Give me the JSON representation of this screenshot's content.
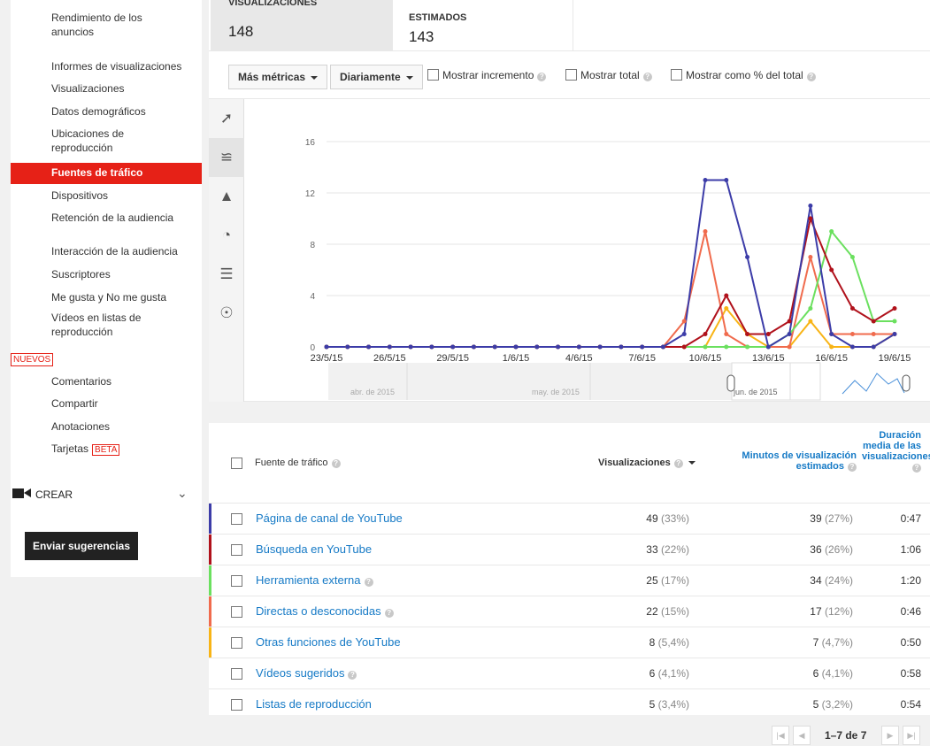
{
  "sidebar": {
    "items": [
      {
        "label": "Rendimiento de los",
        "label2": "anuncios"
      },
      {
        "label": "Informes de visualizaciones"
      },
      {
        "label": "Visualizaciones"
      },
      {
        "label": "Datos demográficos"
      },
      {
        "label": "Ubicaciones de",
        "label2": "reproducción"
      },
      {
        "label": "Fuentes de tráfico"
      },
      {
        "label": "Dispositivos"
      },
      {
        "label": "Retención de la audiencia"
      },
      {
        "label": "Interacción de la audiencia"
      },
      {
        "label": "Suscriptores"
      },
      {
        "label": "Me gusta y No me gusta"
      },
      {
        "label": "Vídeos en listas de",
        "label2": "reproducción"
      },
      {
        "label": "Comentarios"
      },
      {
        "label": "Compartir"
      },
      {
        "label": "Anotaciones"
      },
      {
        "label": "Tarjetas"
      }
    ],
    "nuevos_badge": "NUEVOS",
    "beta_badge": "BETA",
    "crear_label": "CREAR",
    "feedback_button": "Enviar sugerencias"
  },
  "metrics": {
    "views_title": "VISUALIZACIONES",
    "views_value": "148",
    "est_title": "ESTIMADOS",
    "est_value": "143"
  },
  "toolbar": {
    "more_metrics": "Más métricas",
    "daily": "Diariamente",
    "show_increment": "Mostrar incremento",
    "show_total": "Mostrar total",
    "show_pct": "Mostrar como % del total"
  },
  "chart_data": {
    "type": "line",
    "x": [
      "23/5/15",
      "24/5/15",
      "25/5/15",
      "26/5/15",
      "27/5/15",
      "28/5/15",
      "29/5/15",
      "30/5/15",
      "31/5/15",
      "1/6/15",
      "2/6/15",
      "3/6/15",
      "4/6/15",
      "5/6/15",
      "6/6/15",
      "7/6/15",
      "8/6/15",
      "9/6/15",
      "10/6/15",
      "11/6/15",
      "12/6/15",
      "13/6/15",
      "14/6/15",
      "15/6/15",
      "16/6/15",
      "17/6/15",
      "18/6/15",
      "19/6/15"
    ],
    "x_tick_labels": [
      "23/5/15",
      "26/5/15",
      "29/5/15",
      "1/6/15",
      "4/6/15",
      "7/6/15",
      "10/6/15",
      "13/6/15",
      "16/6/15",
      "19/6/15"
    ],
    "y_ticks": [
      0,
      4,
      8,
      12,
      16
    ],
    "ylim": [
      0,
      16
    ],
    "series": [
      {
        "color": "#3c3ca8",
        "values": [
          0,
          0,
          0,
          0,
          0,
          0,
          0,
          0,
          0,
          0,
          0,
          0,
          0,
          0,
          0,
          0,
          0,
          1,
          13,
          13,
          7,
          0,
          1,
          11,
          1,
          0,
          0,
          1
        ]
      },
      {
        "color": "#b0111b",
        "values": [
          0,
          0,
          0,
          0,
          0,
          0,
          0,
          0,
          0,
          0,
          0,
          0,
          0,
          0,
          0,
          0,
          0,
          0,
          1,
          4,
          1,
          1,
          2,
          10,
          6,
          3,
          2,
          3
        ]
      },
      {
        "color": "#6be05f",
        "values": [
          0,
          0,
          0,
          0,
          0,
          0,
          0,
          0,
          0,
          0,
          0,
          0,
          0,
          0,
          0,
          0,
          0,
          0,
          0,
          0,
          0,
          0,
          1,
          3,
          9,
          7,
          2,
          2
        ]
      },
      {
        "color": "#f06b4d",
        "values": [
          0,
          0,
          0,
          0,
          0,
          0,
          0,
          0,
          0,
          0,
          0,
          0,
          0,
          0,
          0,
          0,
          0,
          2,
          9,
          1,
          0,
          0,
          0,
          7,
          1,
          1,
          1,
          1
        ]
      },
      {
        "color": "#f8b416",
        "values": [
          0,
          0,
          0,
          0,
          0,
          0,
          0,
          0,
          0,
          0,
          0,
          0,
          0,
          0,
          0,
          0,
          0,
          0,
          0,
          3,
          1,
          0,
          0,
          2,
          0,
          0,
          0,
          1
        ]
      }
    ],
    "navigator_labels": [
      "abr. de 2015",
      "may. de 2015",
      "jun. de 2015"
    ]
  },
  "table": {
    "col_source": "Fuente de tráfico",
    "col_views": "Visualizaciones",
    "col_minutes": "Minutos de visualización estimados",
    "col_duration": "Duración media de las visualizaciones",
    "rows": [
      {
        "source": "Página de canal de YouTube",
        "help": false,
        "color": "#3c3ca8",
        "views": "49",
        "views_pct": "(33%)",
        "minutes": "39",
        "minutes_pct": "(27%)",
        "duration": "0:47"
      },
      {
        "source": "Búsqueda en YouTube",
        "help": false,
        "color": "#b0111b",
        "views": "33",
        "views_pct": "(22%)",
        "minutes": "36",
        "minutes_pct": "(26%)",
        "duration": "1:06"
      },
      {
        "source": "Herramienta externa",
        "help": true,
        "color": "#6be05f",
        "views": "25",
        "views_pct": "(17%)",
        "minutes": "34",
        "minutes_pct": "(24%)",
        "duration": "1:20"
      },
      {
        "source": "Directas o desconocidas",
        "help": true,
        "color": "#f06b4d",
        "views": "22",
        "views_pct": "(15%)",
        "minutes": "17",
        "minutes_pct": "(12%)",
        "duration": "0:46"
      },
      {
        "source": "Otras funciones de YouTube",
        "help": false,
        "color": "#f8b416",
        "views": "8",
        "views_pct": "(5,4%)",
        "minutes": "7",
        "minutes_pct": "(4,7%)",
        "duration": "0:50"
      },
      {
        "source": "Vídeos sugeridos",
        "help": true,
        "color": "",
        "views": "6",
        "views_pct": "(4,1%)",
        "minutes": "6",
        "minutes_pct": "(4,1%)",
        "duration": "0:58"
      },
      {
        "source": "Listas de reproducción",
        "help": false,
        "color": "",
        "views": "5",
        "views_pct": "(3,4%)",
        "minutes": "5",
        "minutes_pct": "(3,2%)",
        "duration": "0:54"
      }
    ]
  },
  "pager": {
    "text": "1–7 de 7"
  }
}
